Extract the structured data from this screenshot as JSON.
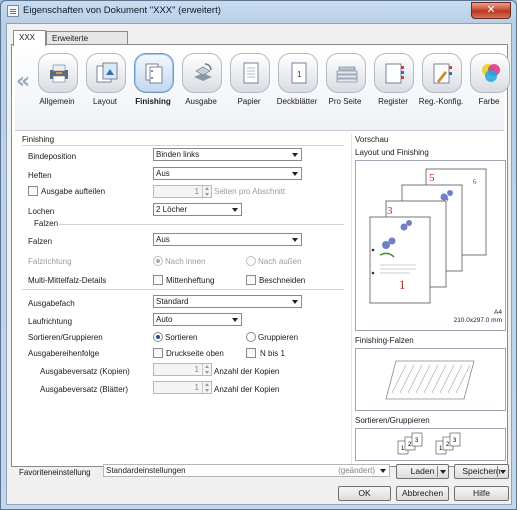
{
  "window": {
    "title": "Eigenschaften von Dokument \"XXX\" (erweitert)"
  },
  "tabs": [
    {
      "label": "XXX",
      "active": true
    },
    {
      "label": "Erweiterte Optionen",
      "active": false
    }
  ],
  "categories": [
    {
      "label": "Allgemein",
      "icon": "printer-icon",
      "selected": false
    },
    {
      "label": "Layout",
      "icon": "layout-icon",
      "selected": false
    },
    {
      "label": "Finishing",
      "icon": "finishing-icon",
      "selected": true
    },
    {
      "label": "Ausgabe",
      "icon": "output-tray-icon",
      "selected": false
    },
    {
      "label": "Papier",
      "icon": "paper-icon",
      "selected": false
    },
    {
      "label": "Deckblätter",
      "icon": "cover-page-icon",
      "selected": false
    },
    {
      "label": "Pro Seite",
      "icon": "paper-stack-icon",
      "selected": false
    },
    {
      "label": "Register",
      "icon": "tab-sheets-icon",
      "selected": false
    },
    {
      "label": "Reg.-Konfig.",
      "icon": "tab-config-icon",
      "selected": false
    },
    {
      "label": "Farbe",
      "icon": "color-icon",
      "selected": false
    }
  ],
  "finishing": {
    "group_title": "Finishing",
    "binding_label": "Bindeposition",
    "binding_value": "Binden links",
    "staple_label": "Heften",
    "staple_value": "Aus",
    "split_label": "Ausgabe aufteilen",
    "split_checked": false,
    "split_value": "1",
    "split_unit": "Seiten pro Abschnitt",
    "punch_label": "Lochen",
    "punch_value": "2 Löcher",
    "fold_group_title": "Falzen",
    "fold_label": "Falzen",
    "fold_value": "Aus",
    "fold_direction_label": "Falzrichtung",
    "fold_inward": "Nach innen",
    "fold_outward": "Nach außen",
    "multi_fold_label": "Multi-Mittelfalz-Details",
    "saddle_stitch": "Mittenheftung",
    "trim": "Beschneiden"
  },
  "output": {
    "tray_label": "Ausgabefach",
    "tray_value": "Standard",
    "direction_label": "Laufrichtung",
    "direction_value": "Auto",
    "collate_label": "Sortieren/Gruppieren",
    "collate_sort": "Sortieren",
    "collate_group": "Gruppieren",
    "order_label": "Ausgabereihenfolge",
    "order_face_up": "Druckseite oben",
    "order_n_to_1": "N bis 1",
    "offset_copies_label": "Ausgabeversatz (Kopien)",
    "offset_copies_value": "1",
    "offset_copies_unit": "Anzahl der Kopien",
    "offset_sheets_label": "Ausgabeversatz (Blätter)",
    "offset_sheets_value": "1",
    "offset_sheets_unit": "Anzahl der Kopien"
  },
  "preview": {
    "title": "Vorschau",
    "layout_title": "Layout und Finishing",
    "paper_size": "A4",
    "paper_dims": "210.0x297.0 mm",
    "page_numbers": [
      "1",
      "3",
      "4",
      "5",
      "6"
    ],
    "fold_title": "Finishing-Falzen",
    "collate_title": "Sortieren/Gruppieren",
    "collate_pages": [
      "1",
      "2",
      "3"
    ]
  },
  "favorites": {
    "label": "Favoriteneinstellung",
    "value": "Standardeinstellungen",
    "status": "(geändert)",
    "load_button": "Laden",
    "save_button": "Speichern"
  },
  "buttons": {
    "ok": "OK",
    "cancel": "Abbrechen",
    "help": "Hilfe"
  }
}
